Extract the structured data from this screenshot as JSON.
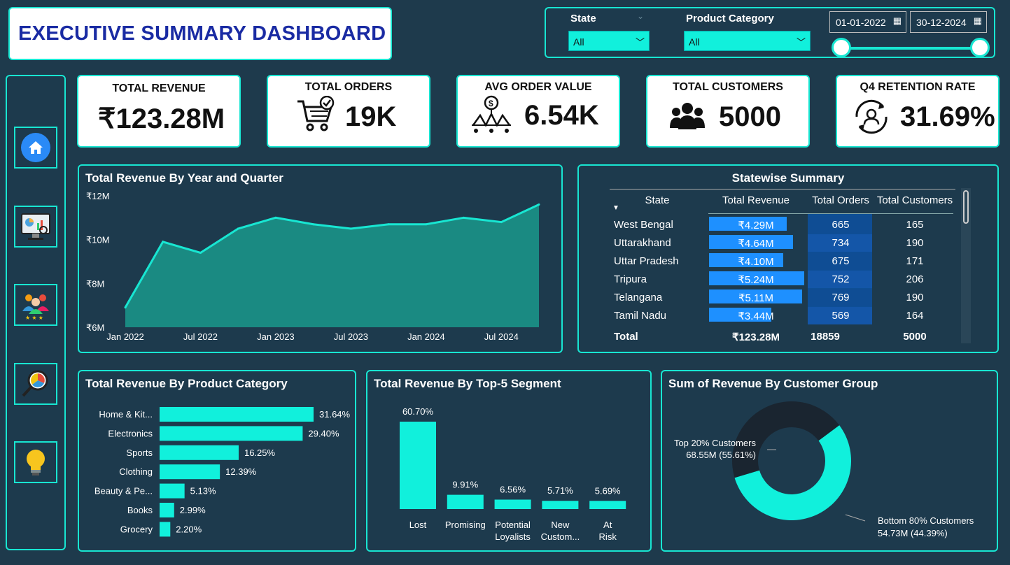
{
  "header": {
    "title": "EXECUTIVE SUMMARY DASHBOARD"
  },
  "filters": {
    "state_label": "State",
    "state_value": "All",
    "category_label": "Product Category",
    "category_value": "All",
    "date_start": "01-01-2022",
    "date_end": "30-12-2024"
  },
  "nav": [
    {
      "icon": "home-icon"
    },
    {
      "icon": "analytics-monitor-icon"
    },
    {
      "icon": "customer-group-icon"
    },
    {
      "icon": "search-analysis-icon"
    },
    {
      "icon": "lightbulb-icon"
    }
  ],
  "kpis": {
    "revenue": {
      "title": "TOTAL REVENUE",
      "value": "₹123.28M"
    },
    "orders": {
      "title": "TOTAL ORDERS",
      "value": "19K"
    },
    "aov": {
      "title": "AVG ORDER VALUE",
      "value": "6.54K"
    },
    "customers": {
      "title": "TOTAL CUSTOMERS",
      "value": "5000"
    },
    "retention": {
      "title": "Q4 RETENTION RATE",
      "value": "31.69%"
    }
  },
  "colors": {
    "accent": "#18e6d2",
    "bar": "#11f0dc",
    "blue": "#1e90ff",
    "navy": "#1a2ba3"
  },
  "revenue_chart": {
    "title": "Total Revenue By Year and Quarter"
  },
  "statewise": {
    "title": "Statewise Summary",
    "columns": [
      "State",
      "Total Revenue",
      "Total Orders",
      "Total Customers"
    ],
    "rows": [
      {
        "state": "West Bengal",
        "revenue": "₹4.29M",
        "rev": 4.29,
        "orders": "665",
        "customers": "165"
      },
      {
        "state": "Uttarakhand",
        "revenue": "₹4.64M",
        "rev": 4.64,
        "orders": "734",
        "customers": "190"
      },
      {
        "state": "Uttar Pradesh",
        "revenue": "₹4.10M",
        "rev": 4.1,
        "orders": "675",
        "customers": "171"
      },
      {
        "state": "Tripura",
        "revenue": "₹5.24M",
        "rev": 5.24,
        "orders": "752",
        "customers": "206"
      },
      {
        "state": "Telangana",
        "revenue": "₹5.11M",
        "rev": 5.11,
        "orders": "769",
        "customers": "190"
      },
      {
        "state": "Tamil Nadu",
        "revenue": "₹3.44M",
        "rev": 3.44,
        "orders": "569",
        "customers": "164"
      }
    ],
    "total": {
      "label": "Total",
      "revenue": "₹123.28M",
      "orders": "18859",
      "customers": "5000"
    }
  },
  "category_chart": {
    "title": "Total Revenue By Product Category"
  },
  "segment_chart": {
    "title": "Total Revenue By Top-5 Segment"
  },
  "group_chart": {
    "title": "Sum of Revenue By Customer Group"
  },
  "chart_data": [
    {
      "type": "area",
      "x": [
        "Q1 2022",
        "Q2 2022",
        "Q3 2022",
        "Q4 2022",
        "Q1 2023",
        "Q2 2023",
        "Q3 2023",
        "Q4 2023",
        "Q1 2024",
        "Q2 2024",
        "Q3 2024",
        "Q4 2024"
      ],
      "values": [
        6.9,
        9.9,
        9.4,
        10.5,
        11.0,
        10.7,
        10.5,
        10.7,
        10.7,
        11.0,
        10.8,
        11.6
      ],
      "xticks": [
        "Jan 2022",
        "Jul 2022",
        "Jan 2023",
        "Jul 2023",
        "Jan 2024",
        "Jul 2024"
      ],
      "yticks": [
        "₹6M",
        "₹8M",
        "₹10M",
        "₹12M"
      ],
      "ylim": [
        6,
        12
      ]
    },
    {
      "type": "bar",
      "categories": [
        "Home & Kit...",
        "Electronics",
        "Sports",
        "Clothing",
        "Beauty & Pe...",
        "Books",
        "Grocery"
      ],
      "values": [
        31.64,
        29.4,
        16.25,
        12.39,
        5.13,
        2.99,
        2.2
      ],
      "labels": [
        "31.64%",
        "29.40%",
        "16.25%",
        "12.39%",
        "5.13%",
        "2.99%",
        "2.20%"
      ]
    },
    {
      "type": "bar",
      "categories": [
        "Lost",
        "Promising",
        "Potential Loyalists",
        "New Custom...",
        "At Risk"
      ],
      "values": [
        60.7,
        9.91,
        6.56,
        5.71,
        5.69
      ],
      "labels": [
        "60.70%",
        "9.91%",
        "6.56%",
        "5.71%",
        "5.69%"
      ]
    },
    {
      "type": "pie",
      "categories": [
        "Top 20% Customers",
        "Bottom 80% Customers"
      ],
      "values": [
        68.55,
        54.73
      ],
      "percent": [
        55.61,
        44.39
      ],
      "labels": [
        "68.55M (55.61%)",
        "54.73M (44.39%)"
      ],
      "colors": [
        "#11f0dc",
        "#1a2530"
      ]
    }
  ]
}
